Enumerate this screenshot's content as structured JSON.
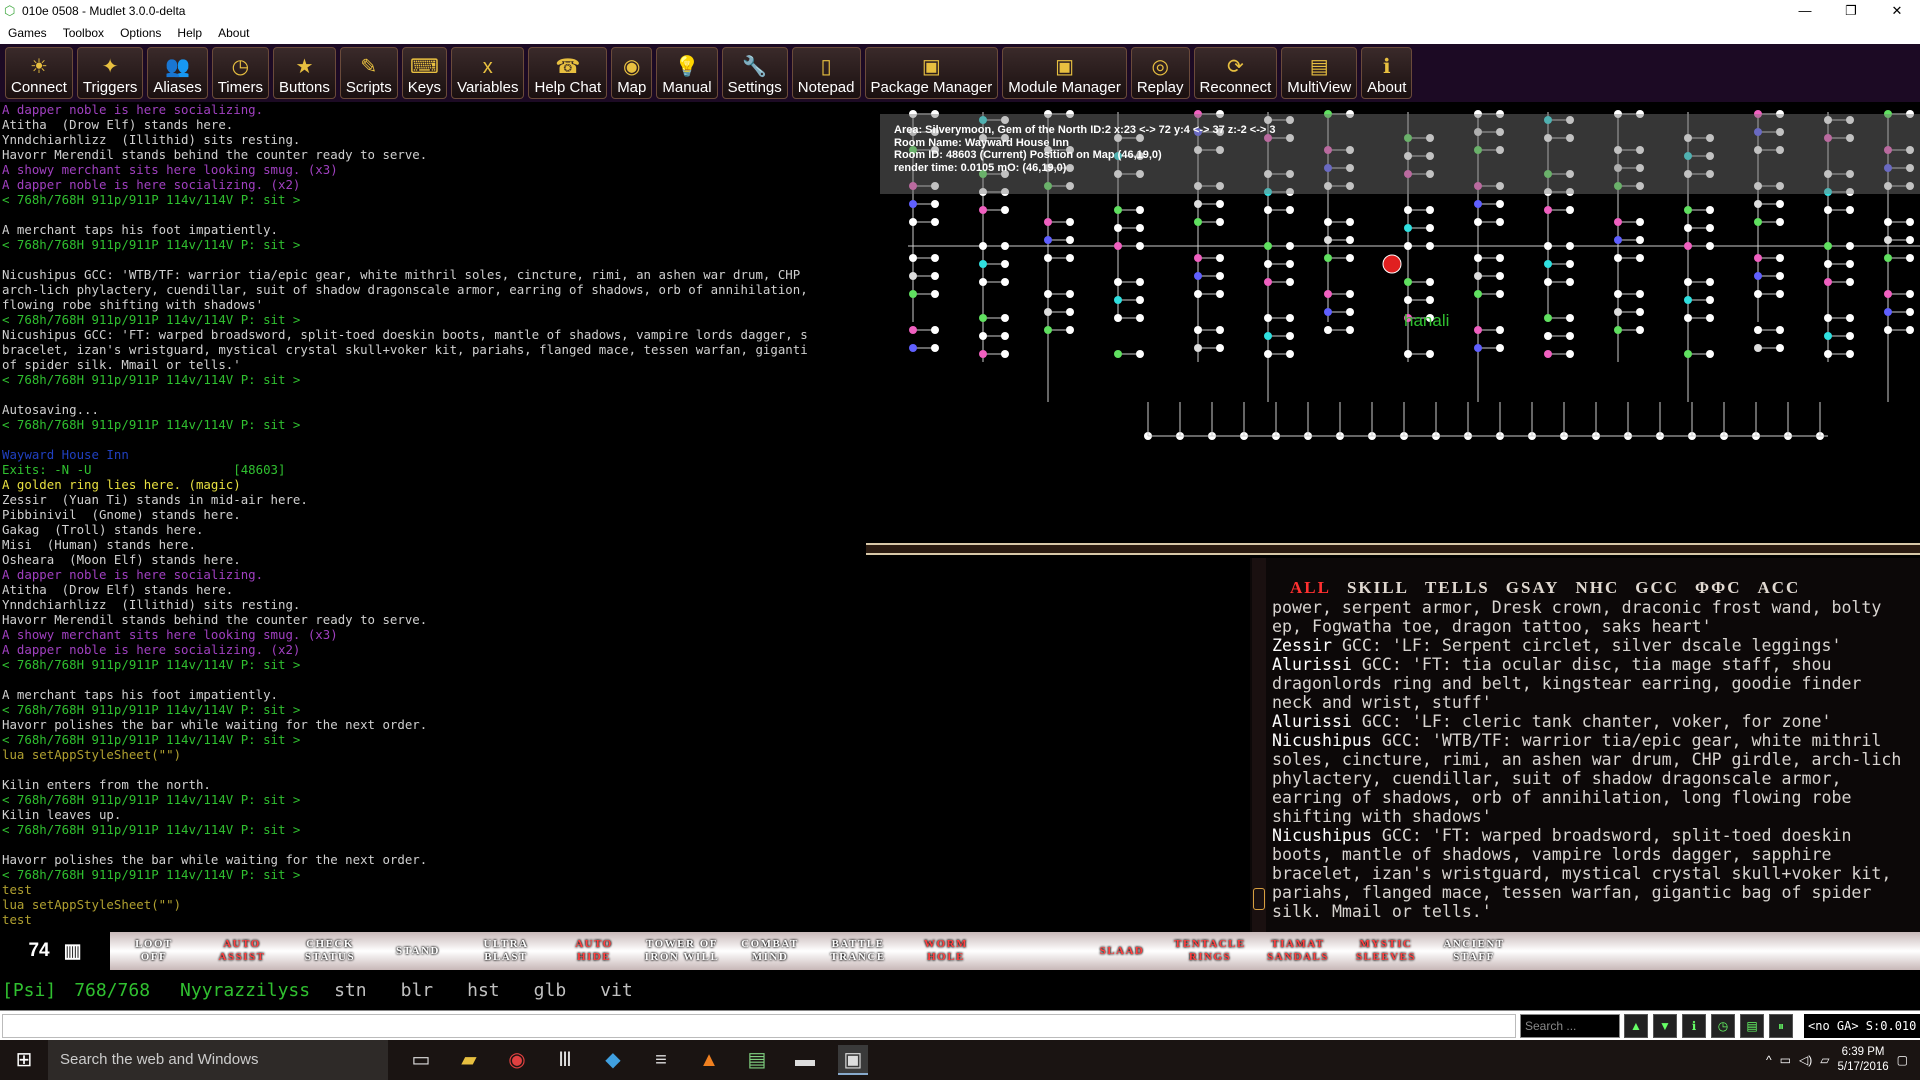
{
  "window": {
    "title": "010e 0508 - Mudlet 3.0.0-delta",
    "minimize": "—",
    "maximize": "❐",
    "close": "✕"
  },
  "menu": [
    "Games",
    "Toolbox",
    "Options",
    "Help",
    "About"
  ],
  "toolbar": [
    {
      "label": "Connect",
      "icon": "☀"
    },
    {
      "label": "Triggers",
      "icon": "✦"
    },
    {
      "label": "Aliases",
      "icon": "👥"
    },
    {
      "label": "Timers",
      "icon": "◷"
    },
    {
      "label": "Buttons",
      "icon": "★"
    },
    {
      "label": "Scripts",
      "icon": "✎"
    },
    {
      "label": "Keys",
      "icon": "⌨"
    },
    {
      "label": "Variables",
      "icon": "x"
    },
    {
      "label": "Help Chat",
      "icon": "☎"
    },
    {
      "label": "Map",
      "icon": "◉"
    },
    {
      "label": "Manual",
      "icon": "💡"
    },
    {
      "label": "Settings",
      "icon": "🔧"
    },
    {
      "label": "Notepad",
      "icon": "▯"
    },
    {
      "label": "Package Manager",
      "icon": "▣"
    },
    {
      "label": "Module Manager",
      "icon": "▣"
    },
    {
      "label": "Replay",
      "icon": "◎"
    },
    {
      "label": "Reconnect",
      "icon": "⟳"
    },
    {
      "label": "MultiView",
      "icon": "▤"
    },
    {
      "label": "About",
      "icon": "ℹ"
    }
  ],
  "console": [
    {
      "t": "A dapper noble is here socializing.",
      "c": "#a040c0"
    },
    {
      "t": "Atitha  (Drow Elf) stands here.",
      "c": "#d0d0d0"
    },
    {
      "t": "Ynndchiarhlizz  (Illithid) sits resting.",
      "c": "#d0d0d0"
    },
    {
      "t": "Havorr Merendil stands behind the counter ready to serve.",
      "c": "#d0d0d0"
    },
    {
      "t": "A showy merchant sits here looking smug. (x3)",
      "c": "#a040c0"
    },
    {
      "t": "A dapper noble is here socializing. (x2)",
      "c": "#a040c0"
    },
    {
      "t": "< 768h/768H 911p/911P 114v/114V P: sit >",
      "c": "#30c030"
    },
    {
      "t": "",
      "c": "#d0d0d0"
    },
    {
      "t": "A merchant taps his foot impatiently.",
      "c": "#d0d0d0"
    },
    {
      "t": "< 768h/768H 911p/911P 114v/114V P: sit >",
      "c": "#30c030"
    },
    {
      "t": "",
      "c": "#d0d0d0"
    },
    {
      "t": "Nicushipus GCC: 'WTB/TF: warrior tia/epic gear, white mithril soles, cincture, rimi, an ashen war drum, CHP",
      "c": "#d0d0d0"
    },
    {
      "t": "arch-lich phylactery, cuendillar, suit of shadow dragonscale armor, earring of shadows, orb of annihilation,",
      "c": "#d0d0d0"
    },
    {
      "t": "flowing robe shifting with shadows'",
      "c": "#d0d0d0"
    },
    {
      "t": "< 768h/768H 911p/911P 114v/114V P: sit >",
      "c": "#30c030"
    },
    {
      "t": "Nicushipus GCC: 'FT: warped broadsword, split-toed doeskin boots, mantle of shadows, vampire lords dagger, s",
      "c": "#d0d0d0"
    },
    {
      "t": "bracelet, izan's wristguard, mystical crystal skull+voker kit, pariahs, flanged mace, tessen warfan, giganti",
      "c": "#d0d0d0"
    },
    {
      "t": "of spider silk. Mmail or tells.'",
      "c": "#d0d0d0"
    },
    {
      "t": "< 768h/768H 911p/911P 114v/114V P: sit >",
      "c": "#30c030"
    },
    {
      "t": "",
      "c": "#d0d0d0"
    },
    {
      "t": "Autosaving...",
      "c": "#d0d0d0"
    },
    {
      "t": "< 768h/768H 911p/911P 114v/114V P: sit >",
      "c": "#30c030"
    },
    {
      "t": "",
      "c": "#d0d0d0"
    },
    {
      "t": "Wayward House Inn",
      "c": "#2040c0"
    },
    {
      "t": "Exits: -N -U                   [48603]",
      "c": "#30c030"
    },
    {
      "t": "A golden ring lies here. (magic)",
      "c": "#e8e040"
    },
    {
      "t": "Zessir  (Yuan Ti) stands in mid-air here.",
      "c": "#d0d0d0"
    },
    {
      "t": "Pibbinivil  (Gnome) stands here.",
      "c": "#d0d0d0"
    },
    {
      "t": "Gakag  (Troll) stands here.",
      "c": "#d0d0d0"
    },
    {
      "t": "Misi  (Human) stands here.",
      "c": "#d0d0d0"
    },
    {
      "t": "Osheara  (Moon Elf) stands here.",
      "c": "#d0d0d0"
    },
    {
      "t": "A dapper noble is here socializing.",
      "c": "#a040c0"
    },
    {
      "t": "Atitha  (Drow Elf) stands here.",
      "c": "#d0d0d0"
    },
    {
      "t": "Ynndchiarhlizz  (Illithid) sits resting.",
      "c": "#d0d0d0"
    },
    {
      "t": "Havorr Merendil stands behind the counter ready to serve.",
      "c": "#d0d0d0"
    },
    {
      "t": "A showy merchant sits here looking smug. (x3)",
      "c": "#a040c0"
    },
    {
      "t": "A dapper noble is here socializing. (x2)",
      "c": "#a040c0"
    },
    {
      "t": "< 768h/768H 911p/911P 114v/114V P: sit >",
      "c": "#30c030"
    },
    {
      "t": "",
      "c": "#d0d0d0"
    },
    {
      "t": "A merchant taps his foot impatiently.",
      "c": "#d0d0d0"
    },
    {
      "t": "< 768h/768H 911p/911P 114v/114V P: sit >",
      "c": "#30c030"
    },
    {
      "t": "Havorr polishes the bar while waiting for the next order.",
      "c": "#d0d0d0"
    },
    {
      "t": "< 768h/768H 911p/911P 114v/114V P: sit >",
      "c": "#30c030"
    },
    {
      "t": "lua setAppStyleSheet(\"\")",
      "c": "#b0a030"
    },
    {
      "t": "",
      "c": "#d0d0d0"
    },
    {
      "t": "Kilin enters from the north.",
      "c": "#d0d0d0"
    },
    {
      "t": "< 768h/768H 911p/911P 114v/114V P: sit >",
      "c": "#30c030"
    },
    {
      "t": "Kilin leaves up.",
      "c": "#d0d0d0"
    },
    {
      "t": "< 768h/768H 911p/911P 114v/114V P: sit >",
      "c": "#30c030"
    },
    {
      "t": "",
      "c": "#d0d0d0"
    },
    {
      "t": "Havorr polishes the bar while waiting for the next order.",
      "c": "#d0d0d0"
    },
    {
      "t": "< 768h/768H 911p/911P 114v/114V P: sit >",
      "c": "#30c030"
    },
    {
      "t": "test",
      "c": "#b0a030"
    },
    {
      "t": "lua setAppStyleSheet(\"\")",
      "c": "#b0a030"
    },
    {
      "t": "test",
      "c": "#b0a030"
    }
  ],
  "map": {
    "area": "Area: Silverymoon, Gem of the North ID:2 x:23 <-> 72 y:4 <-> 37 z:-2 <-> 3",
    "room_name": "Room Name: Wayward House Inn",
    "room_id": "Room ID: 48603 (Current) Position on Map (46,19,0)",
    "render": "render time: 0.0105 mO: (46,19,0)",
    "label": "hanali"
  },
  "chat": {
    "tabs": [
      "ALL",
      "SKILL",
      "TELLS",
      "GSAY",
      "NHC",
      "GCC",
      "ΦΦC",
      "ACC"
    ],
    "lines": [
      {
        "name": "",
        "text": "power, serpent armor, Dresk crown, draconic frost wand, bolty"
      },
      {
        "name": "",
        "text": "ep, Fogwatha toe, dragon tattoo, saks heart'"
      },
      {
        "name": "Zessir",
        "text": " GCC: 'LF: Serpent circlet, silver dscale leggings'"
      },
      {
        "name": "Alurissi",
        "text": " GCC: 'FT: tia ocular disc, tia mage staff, shou"
      },
      {
        "name": "",
        "text": "dragonlords ring and belt, kingstear earring, goodie finder"
      },
      {
        "name": "",
        "text": "neck and wrist, stuff'"
      },
      {
        "name": "Alurissi",
        "text": " GCC: 'LF: cleric tank chanter, voker, for zone'"
      },
      {
        "name": "Nicushipus",
        "text": " GCC: 'WTB/TF: warrior tia/epic gear, white mithril"
      },
      {
        "name": "",
        "text": "soles, cincture, rimi, an ashen war drum, CHP girdle, arch-lich"
      },
      {
        "name": "",
        "text": "phylactery, cuendillar, suit of shadow dragonscale armor,"
      },
      {
        "name": "",
        "text": "earring of shadows, orb of annihilation, long flowing robe"
      },
      {
        "name": "",
        "text": "shifting with shadows'"
      },
      {
        "name": "Nicushipus",
        "text": " GCC: 'FT: warped broadsword, split-toed doeskin"
      },
      {
        "name": "",
        "text": "boots, mantle of shadows, vampire lords dagger, sapphire"
      },
      {
        "name": "",
        "text": "bracelet, izan's wristguard, mystical crystal skull+voker kit,"
      },
      {
        "name": "",
        "text": "pariahs, flanged mace, tessen warfan, gigantic bag of spider"
      },
      {
        "name": "",
        "text": "silk. Mmail or tells.'"
      }
    ]
  },
  "buttonbar": {
    "count": "74",
    "icon": "▥",
    "buttons": [
      {
        "l1": "LOOT",
        "l2": "OFF",
        "red": false
      },
      {
        "l1": "AUTO",
        "l2": "ASSIST",
        "red": true
      },
      {
        "l1": "CHECK",
        "l2": "STATUS",
        "red": false
      },
      {
        "l1": "STAND",
        "l2": "",
        "red": false
      },
      {
        "l1": "ULTRA",
        "l2": "BLAST",
        "red": false
      },
      {
        "l1": "AUTO",
        "l2": "HIDE",
        "red": true
      },
      {
        "l1": "TOWER OF",
        "l2": "IRON WILL",
        "red": false
      },
      {
        "l1": "COMBAT",
        "l2": "MIND",
        "red": false
      },
      {
        "l1": "BATTLE",
        "l2": "TRANCE",
        "red": false
      },
      {
        "l1": "WORM",
        "l2": "HOLE",
        "red": true
      },
      {
        "l1": "",
        "l2": "",
        "red": false
      },
      {
        "l1": "SLAAD",
        "l2": "",
        "red": true
      },
      {
        "l1": "TENTACLE",
        "l2": "RINGS",
        "red": true
      },
      {
        "l1": "TIAMAT",
        "l2": "SANDALS",
        "red": true
      },
      {
        "l1": "MYSTIC",
        "l2": "SLEEVES",
        "red": true
      },
      {
        "l1": "ANCIENT",
        "l2": "STAFF",
        "red": false
      }
    ]
  },
  "status": {
    "psi": "[Psi]",
    "hp": "768/768",
    "name": "Nyyrazzilyss",
    "cmds": [
      "stn",
      "blr",
      "hst",
      "glb",
      "vit"
    ]
  },
  "input": {
    "search_placeholder": "Search ...",
    "ga": "<no GA> S:0.010"
  },
  "taskbar": {
    "search": "Search the web and Windows",
    "time": "6:39 PM",
    "date": "5/17/2016"
  }
}
